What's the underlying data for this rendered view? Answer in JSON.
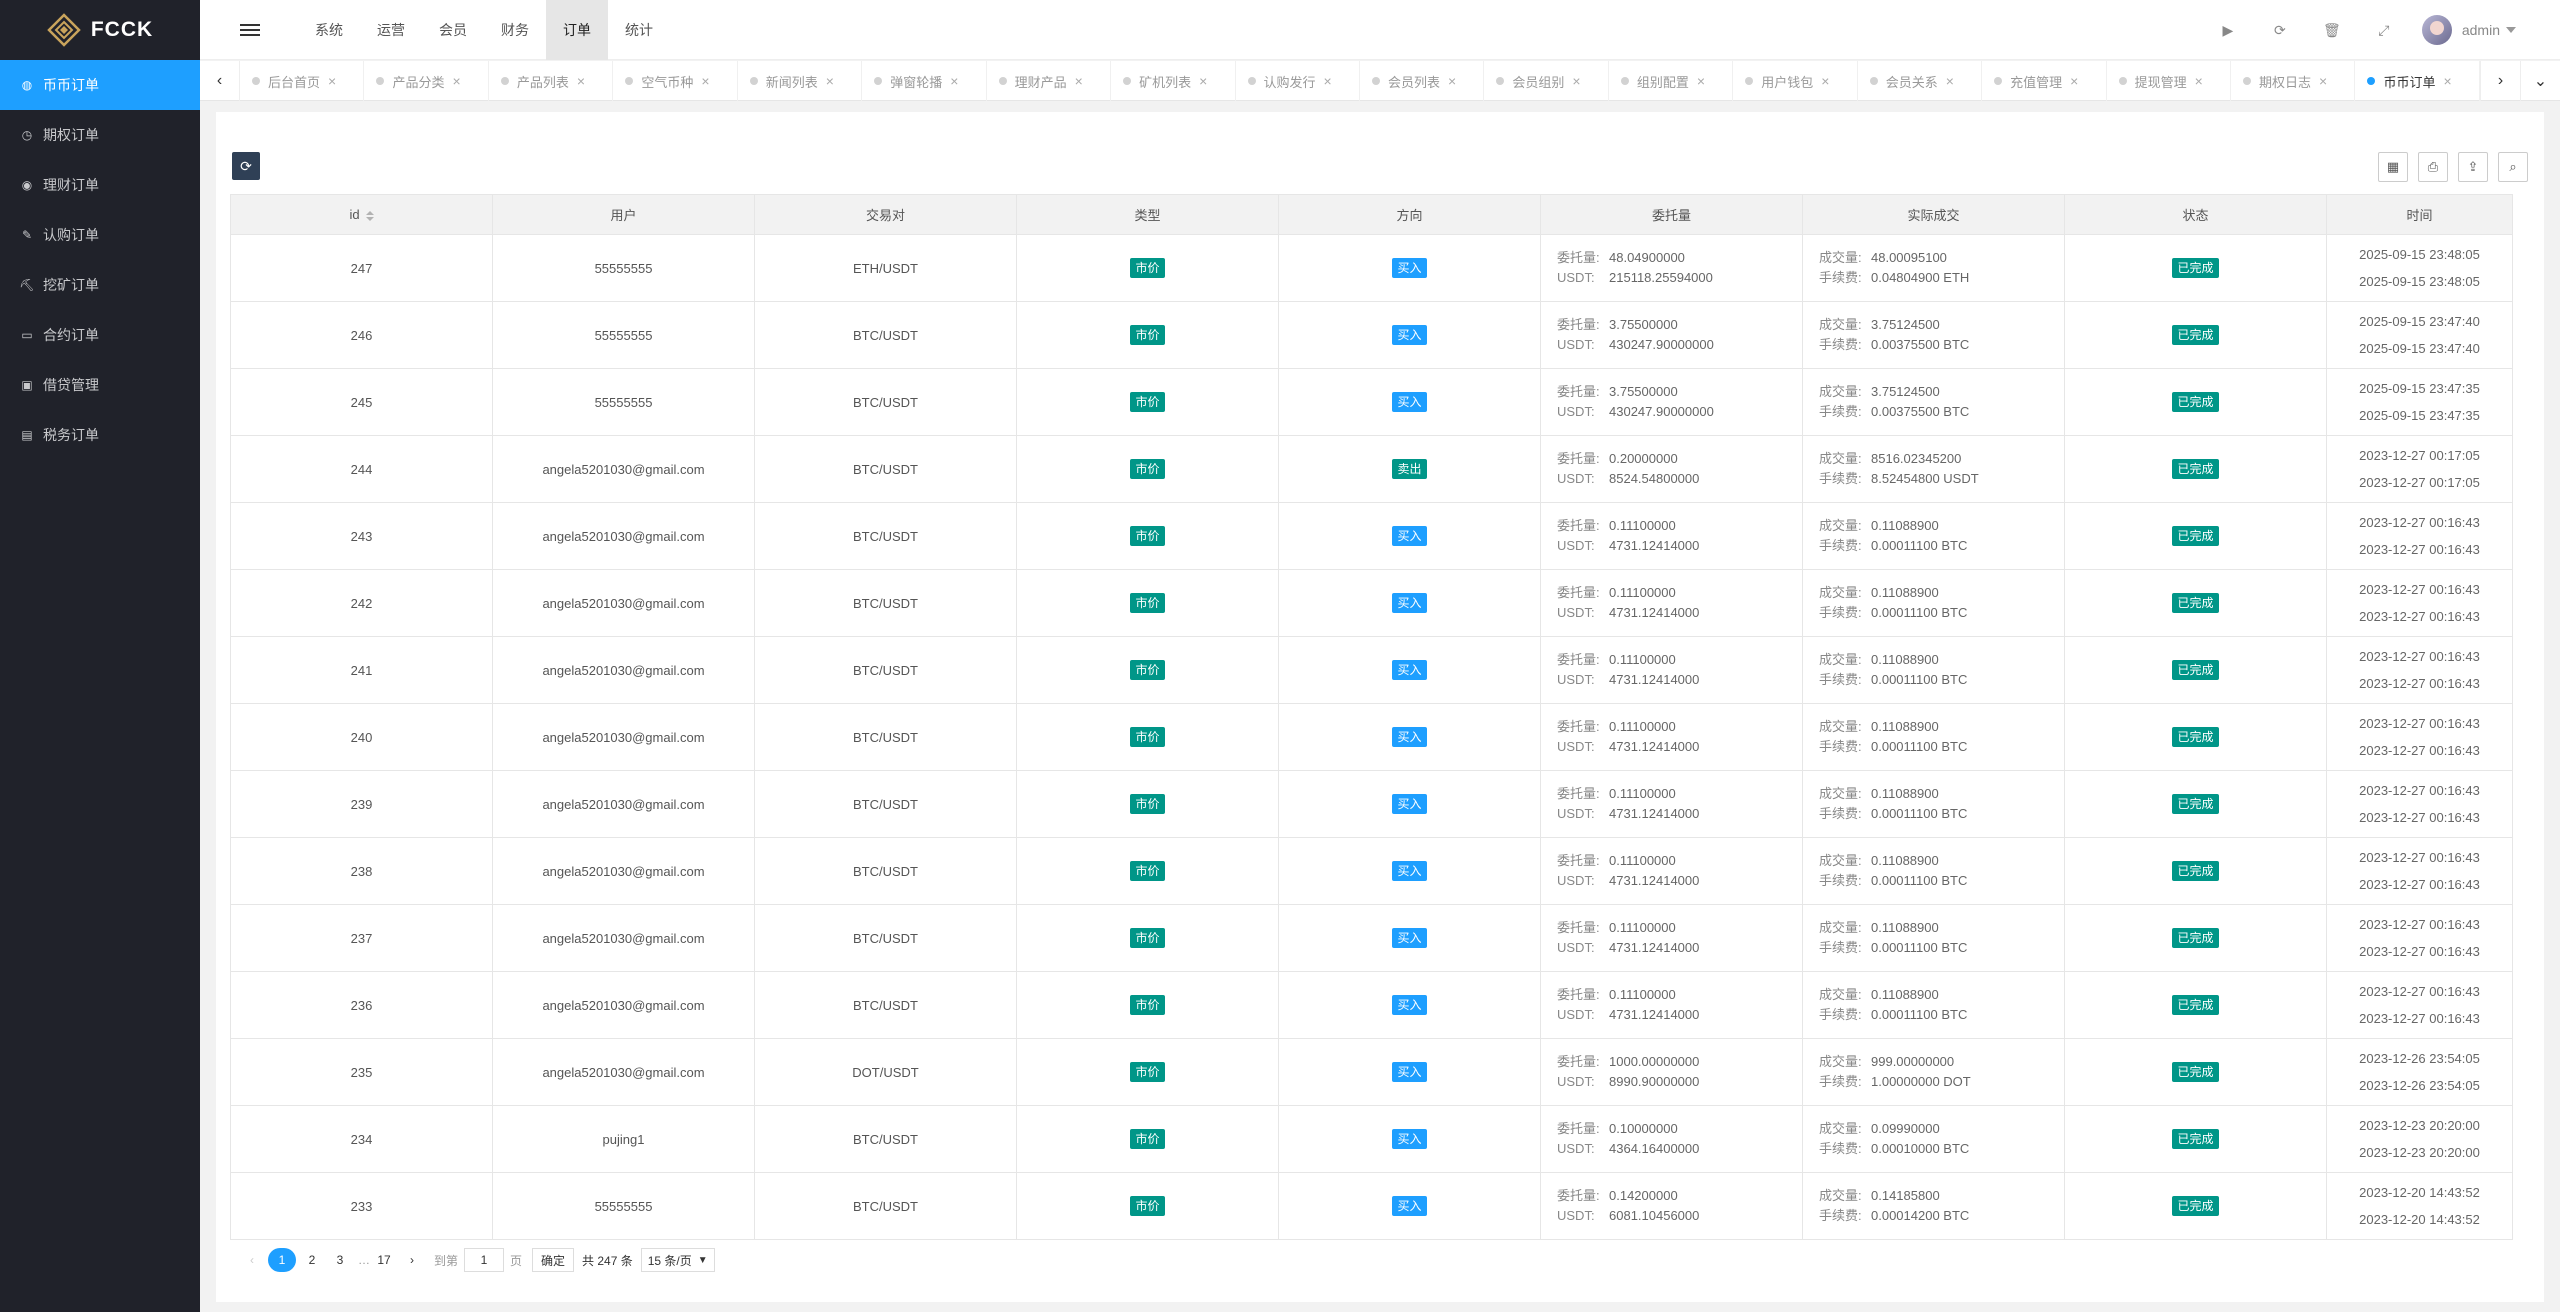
{
  "brand": {
    "name": "FCCK"
  },
  "sidebar": {
    "items": [
      {
        "label": "币币订单",
        "icon": "coin-icon",
        "glyph": "◍",
        "active": true
      },
      {
        "label": "期权订单",
        "icon": "clock-icon",
        "glyph": "◷",
        "active": false
      },
      {
        "label": "理财订单",
        "icon": "wealth-icon",
        "glyph": "◉",
        "active": false
      },
      {
        "label": "认购订单",
        "icon": "walk-icon",
        "glyph": "✎",
        "active": false
      },
      {
        "label": "挖矿订单",
        "icon": "mining-icon",
        "glyph": "⛏",
        "active": false
      },
      {
        "label": "合约订单",
        "icon": "monitor-icon",
        "glyph": "▭",
        "active": false
      },
      {
        "label": "借贷管理",
        "icon": "cash-icon",
        "glyph": "▣",
        "active": false
      },
      {
        "label": "税务订单",
        "icon": "receipt-icon",
        "glyph": "▤",
        "active": false
      }
    ]
  },
  "header": {
    "nav": [
      {
        "label": "系统",
        "active": false
      },
      {
        "label": "运营",
        "active": false
      },
      {
        "label": "会员",
        "active": false
      },
      {
        "label": "财务",
        "active": false
      },
      {
        "label": "订单",
        "active": true
      },
      {
        "label": "统计",
        "active": false
      }
    ],
    "user": {
      "name": "admin"
    }
  },
  "tabs": [
    {
      "label": "后台首页",
      "active": false
    },
    {
      "label": "产品分类",
      "active": false
    },
    {
      "label": "产品列表",
      "active": false
    },
    {
      "label": "空气币种",
      "active": false
    },
    {
      "label": "新闻列表",
      "active": false
    },
    {
      "label": "弹窗轮播",
      "active": false
    },
    {
      "label": "理财产品",
      "active": false
    },
    {
      "label": "矿机列表",
      "active": false
    },
    {
      "label": "认购发行",
      "active": false
    },
    {
      "label": "会员列表",
      "active": false
    },
    {
      "label": "会员组别",
      "active": false
    },
    {
      "label": "组别配置",
      "active": false
    },
    {
      "label": "用户钱包",
      "active": false
    },
    {
      "label": "会员关系",
      "active": false
    },
    {
      "label": "充值管理",
      "active": false
    },
    {
      "label": "提现管理",
      "active": false
    },
    {
      "label": "期权日志",
      "active": false
    },
    {
      "label": "币币订单",
      "active": true
    }
  ],
  "table": {
    "columns": [
      "id",
      "用户",
      "交易对",
      "类型",
      "方向",
      "委托量",
      "实际成交",
      "状态",
      "时间"
    ],
    "labels": {
      "order_amount": "委托量:",
      "usdt": "USDT:",
      "deal_amount": "成交量:",
      "fee": "手续费:"
    },
    "rows": [
      {
        "id": "247",
        "user": "55555555",
        "pair": "ETH/USDT",
        "type": "市价",
        "dir": "买入",
        "dir_color": "blue",
        "amount": "48.04900000",
        "usdt": "215118.25594000",
        "deal": "48.00095100",
        "fee": "0.04804900 ETH",
        "status": "已完成",
        "time1": "2025-09-15 23:48:05",
        "time2": "2025-09-15 23:48:05"
      },
      {
        "id": "246",
        "user": "55555555",
        "pair": "BTC/USDT",
        "type": "市价",
        "dir": "买入",
        "dir_color": "blue",
        "amount": "3.75500000",
        "usdt": "430247.90000000",
        "deal": "3.75124500",
        "fee": "0.00375500 BTC",
        "status": "已完成",
        "time1": "2025-09-15 23:47:40",
        "time2": "2025-09-15 23:47:40"
      },
      {
        "id": "245",
        "user": "55555555",
        "pair": "BTC/USDT",
        "type": "市价",
        "dir": "买入",
        "dir_color": "blue",
        "amount": "3.75500000",
        "usdt": "430247.90000000",
        "deal": "3.75124500",
        "fee": "0.00375500 BTC",
        "status": "已完成",
        "time1": "2025-09-15 23:47:35",
        "time2": "2025-09-15 23:47:35"
      },
      {
        "id": "244",
        "user": "angela5201030@gmail.com",
        "pair": "BTC/USDT",
        "type": "市价",
        "dir": "卖出",
        "dir_color": "green",
        "amount": "0.20000000",
        "usdt": "8524.54800000",
        "deal": "8516.02345200",
        "fee": "8.52454800 USDT",
        "status": "已完成",
        "time1": "2023-12-27 00:17:05",
        "time2": "2023-12-27 00:17:05"
      },
      {
        "id": "243",
        "user": "angela5201030@gmail.com",
        "pair": "BTC/USDT",
        "type": "市价",
        "dir": "买入",
        "dir_color": "blue",
        "amount": "0.11100000",
        "usdt": "4731.12414000",
        "deal": "0.11088900",
        "fee": "0.00011100 BTC",
        "status": "已完成",
        "time1": "2023-12-27 00:16:43",
        "time2": "2023-12-27 00:16:43"
      },
      {
        "id": "242",
        "user": "angela5201030@gmail.com",
        "pair": "BTC/USDT",
        "type": "市价",
        "dir": "买入",
        "dir_color": "blue",
        "amount": "0.11100000",
        "usdt": "4731.12414000",
        "deal": "0.11088900",
        "fee": "0.00011100 BTC",
        "status": "已完成",
        "time1": "2023-12-27 00:16:43",
        "time2": "2023-12-27 00:16:43"
      },
      {
        "id": "241",
        "user": "angela5201030@gmail.com",
        "pair": "BTC/USDT",
        "type": "市价",
        "dir": "买入",
        "dir_color": "blue",
        "amount": "0.11100000",
        "usdt": "4731.12414000",
        "deal": "0.11088900",
        "fee": "0.00011100 BTC",
        "status": "已完成",
        "time1": "2023-12-27 00:16:43",
        "time2": "2023-12-27 00:16:43"
      },
      {
        "id": "240",
        "user": "angela5201030@gmail.com",
        "pair": "BTC/USDT",
        "type": "市价",
        "dir": "买入",
        "dir_color": "blue",
        "amount": "0.11100000",
        "usdt": "4731.12414000",
        "deal": "0.11088900",
        "fee": "0.00011100 BTC",
        "status": "已完成",
        "time1": "2023-12-27 00:16:43",
        "time2": "2023-12-27 00:16:43"
      },
      {
        "id": "239",
        "user": "angela5201030@gmail.com",
        "pair": "BTC/USDT",
        "type": "市价",
        "dir": "买入",
        "dir_color": "blue",
        "amount": "0.11100000",
        "usdt": "4731.12414000",
        "deal": "0.11088900",
        "fee": "0.00011100 BTC",
        "status": "已完成",
        "time1": "2023-12-27 00:16:43",
        "time2": "2023-12-27 00:16:43"
      },
      {
        "id": "238",
        "user": "angela5201030@gmail.com",
        "pair": "BTC/USDT",
        "type": "市价",
        "dir": "买入",
        "dir_color": "blue",
        "amount": "0.11100000",
        "usdt": "4731.12414000",
        "deal": "0.11088900",
        "fee": "0.00011100 BTC",
        "status": "已完成",
        "time1": "2023-12-27 00:16:43",
        "time2": "2023-12-27 00:16:43"
      },
      {
        "id": "237",
        "user": "angela5201030@gmail.com",
        "pair": "BTC/USDT",
        "type": "市价",
        "dir": "买入",
        "dir_color": "blue",
        "amount": "0.11100000",
        "usdt": "4731.12414000",
        "deal": "0.11088900",
        "fee": "0.00011100 BTC",
        "status": "已完成",
        "time1": "2023-12-27 00:16:43",
        "time2": "2023-12-27 00:16:43"
      },
      {
        "id": "236",
        "user": "angela5201030@gmail.com",
        "pair": "BTC/USDT",
        "type": "市价",
        "dir": "买入",
        "dir_color": "blue",
        "amount": "0.11100000",
        "usdt": "4731.12414000",
        "deal": "0.11088900",
        "fee": "0.00011100 BTC",
        "status": "已完成",
        "time1": "2023-12-27 00:16:43",
        "time2": "2023-12-27 00:16:43"
      },
      {
        "id": "235",
        "user": "angela5201030@gmail.com",
        "pair": "DOT/USDT",
        "type": "市价",
        "dir": "买入",
        "dir_color": "blue",
        "amount": "1000.00000000",
        "usdt": "8990.90000000",
        "deal": "999.00000000",
        "fee": "1.00000000 DOT",
        "status": "已完成",
        "time1": "2023-12-26 23:54:05",
        "time2": "2023-12-26 23:54:05"
      },
      {
        "id": "234",
        "user": "pujing1",
        "pair": "BTC/USDT",
        "type": "市价",
        "dir": "买入",
        "dir_color": "blue",
        "amount": "0.10000000",
        "usdt": "4364.16400000",
        "deal": "0.09990000",
        "fee": "0.00010000 BTC",
        "status": "已完成",
        "time1": "2023-12-23 20:20:00",
        "time2": "2023-12-23 20:20:00"
      },
      {
        "id": "233",
        "user": "55555555",
        "pair": "BTC/USDT",
        "type": "市价",
        "dir": "买入",
        "dir_color": "blue",
        "amount": "0.14200000",
        "usdt": "6081.10456000",
        "deal": "0.14185800",
        "fee": "0.00014200 BTC",
        "status": "已完成",
        "time1": "2023-12-20 14:43:52",
        "time2": "2023-12-20 14:43:52"
      }
    ]
  },
  "pagination": {
    "pages": [
      "1",
      "2",
      "3"
    ],
    "ellipsis": "…",
    "last": "17",
    "current": "1",
    "goto_prefix": "到第",
    "goto_value": "1",
    "goto_suffix": "页",
    "confirm": "确定",
    "total": "共 247 条",
    "per_page": "15 条/页"
  },
  "colors": {
    "accent": "#1e9fff",
    "green": "#009688",
    "sidebar": "#20222a",
    "dark_btn": "#2f4056"
  }
}
